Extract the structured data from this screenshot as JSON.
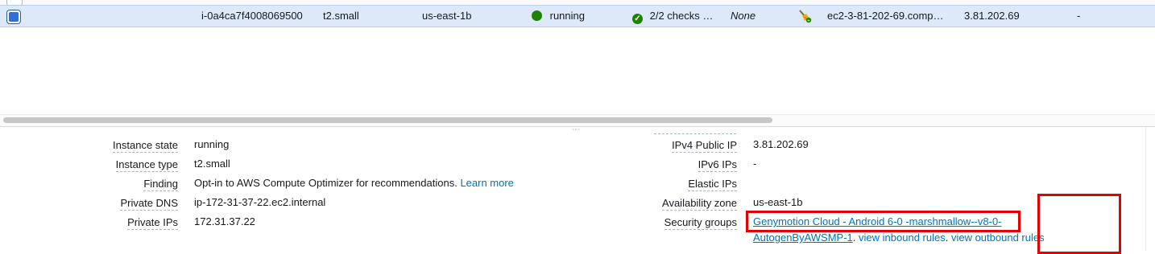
{
  "instance_row": {
    "selected": true,
    "instance_id": "i-0a4ca7f4008069500",
    "instance_type": "t2.small",
    "availability_zone": "us-east-1b",
    "state": "running",
    "state_icon": "running-status-dot-icon",
    "status_checks": "2/2 checks …",
    "status_icon": "check-circle-icon",
    "alarm_status": "None",
    "alarm_icon": "broom-icon",
    "public_dns": "ec2-3-81-202-69.comp…",
    "public_ip": "3.81.202.69",
    "elastic_ip": "-"
  },
  "details": {
    "left": [
      {
        "label": "Instance state",
        "value": "running"
      },
      {
        "label": "Instance type",
        "value": "t2.small"
      },
      {
        "label": "Finding",
        "value": "Opt-in to AWS Compute Optimizer for recommendations.",
        "link": "Learn more"
      },
      {
        "label": "Private DNS",
        "value": "ip-172-31-37-22.ec2.internal"
      },
      {
        "label": "Private IPs",
        "value": "172.31.37.22"
      }
    ],
    "right": [
      {
        "label": "IPv4 Public IP",
        "value": "3.81.202.69"
      },
      {
        "label": "IPv6 IPs",
        "value": "-"
      },
      {
        "label": "Elastic IPs",
        "value": ""
      },
      {
        "label": "Availability zone",
        "value": "us-east-1b"
      },
      {
        "label": "Security groups",
        "value": ""
      }
    ],
    "security_group": {
      "name_line1": "Genymotion Cloud - Android 6-0 -marshmallow--v8-0-",
      "name_line2": "AutogenByAWSMP-1",
      "separator1": ". ",
      "inbound_link": "view inbound rules",
      "separator2": ". ",
      "outbound_link": "view outbound rules"
    }
  },
  "colors": {
    "selected_row_bg": "#dde9f8",
    "link": "#0073bb",
    "status_green": "#1d8102",
    "highlight_red": "#e60000"
  }
}
